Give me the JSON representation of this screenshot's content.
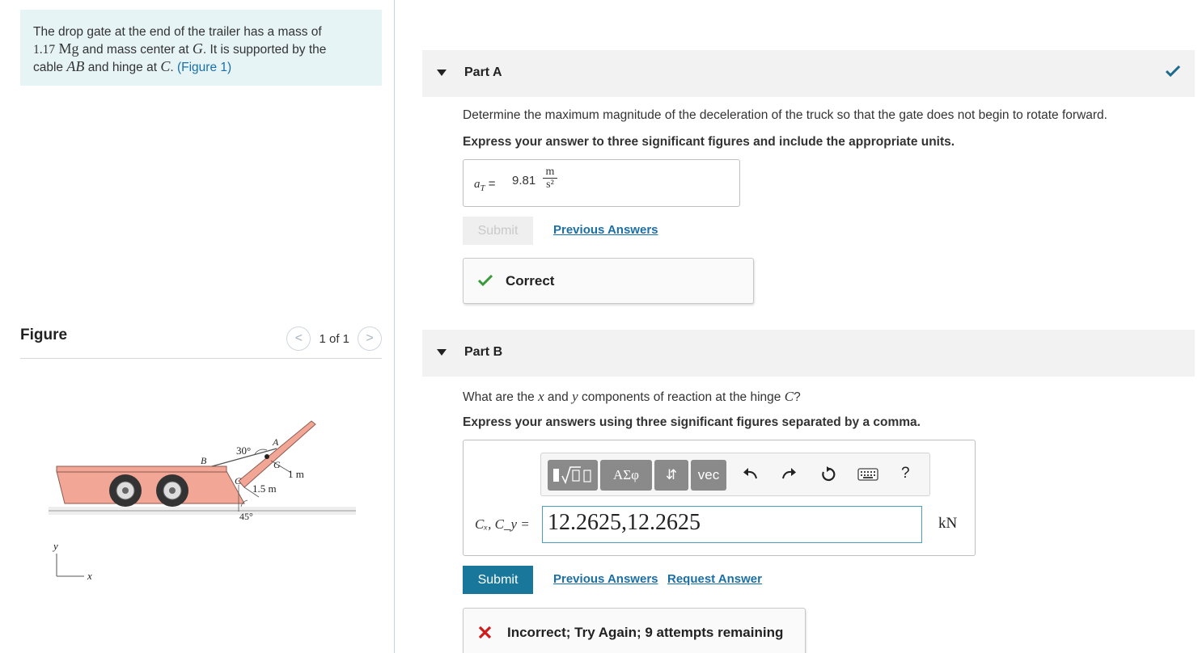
{
  "problem": {
    "text_1": "The drop gate at the end of the trailer has a mass of",
    "mass_value": "1.17",
    "mass_unit": "Mg",
    "text_2": "and mass center at",
    "point_g": "G",
    "text_3": ". It is supported by the",
    "text_4": "cable",
    "cable": "AB",
    "text_5": "and hinge at",
    "point_c": "C",
    "text_6": ".",
    "figure_link": "(Figure 1)"
  },
  "figure": {
    "title": "Figure",
    "count": "1 of 1",
    "prev_glyph": "<",
    "next_glyph": ">",
    "labels": {
      "angle_top": "30°",
      "point_a": "A",
      "point_b": "B",
      "point_g": "G",
      "point_c": "C",
      "dim_1m": "1 m",
      "dim_15m": "1.5 m",
      "angle_bottom": "45°",
      "axis_y": "y",
      "axis_x": "x"
    }
  },
  "partA": {
    "title": "Part A",
    "question": "Determine the maximum magnitude of the deceleration of the truck so that the gate does not begin to rotate forward.",
    "instruction": "Express your answer to three significant figures and include the appropriate units.",
    "answer_label_var": "a",
    "answer_label_sub": "T",
    "answer_eq": "=",
    "answer_value": "9.81",
    "unit_num": "m",
    "unit_den": "s²",
    "submit_label": "Submit",
    "previous_answers": "Previous Answers",
    "feedback": "Correct"
  },
  "partB": {
    "title": "Part B",
    "question_1": "What are the",
    "var_x": "x",
    "question_2": "and",
    "var_y": "y",
    "question_3": "components of reaction at the hinge",
    "var_c": "C",
    "question_4": "?",
    "instruction": "Express your answers using three significant figures separated by a comma.",
    "toolbar": {
      "greek": "ΑΣφ",
      "arrows": "⇵",
      "vec": "vec",
      "help": "?"
    },
    "input_label": "Cₓ, C_y =",
    "input_value": "12.2625,12.2625",
    "unit": "kN",
    "submit_label": "Submit",
    "previous_answers": "Previous Answers",
    "request_answer": "Request Answer",
    "feedback": "Incorrect; Try Again; 9 attempts remaining"
  },
  "colors": {
    "check_green": "#3a9a3a",
    "error_red": "#d11a1a",
    "link_blue": "#1a6fa6",
    "submit_blue": "#18779b",
    "header_check": "#1d6a8c"
  }
}
